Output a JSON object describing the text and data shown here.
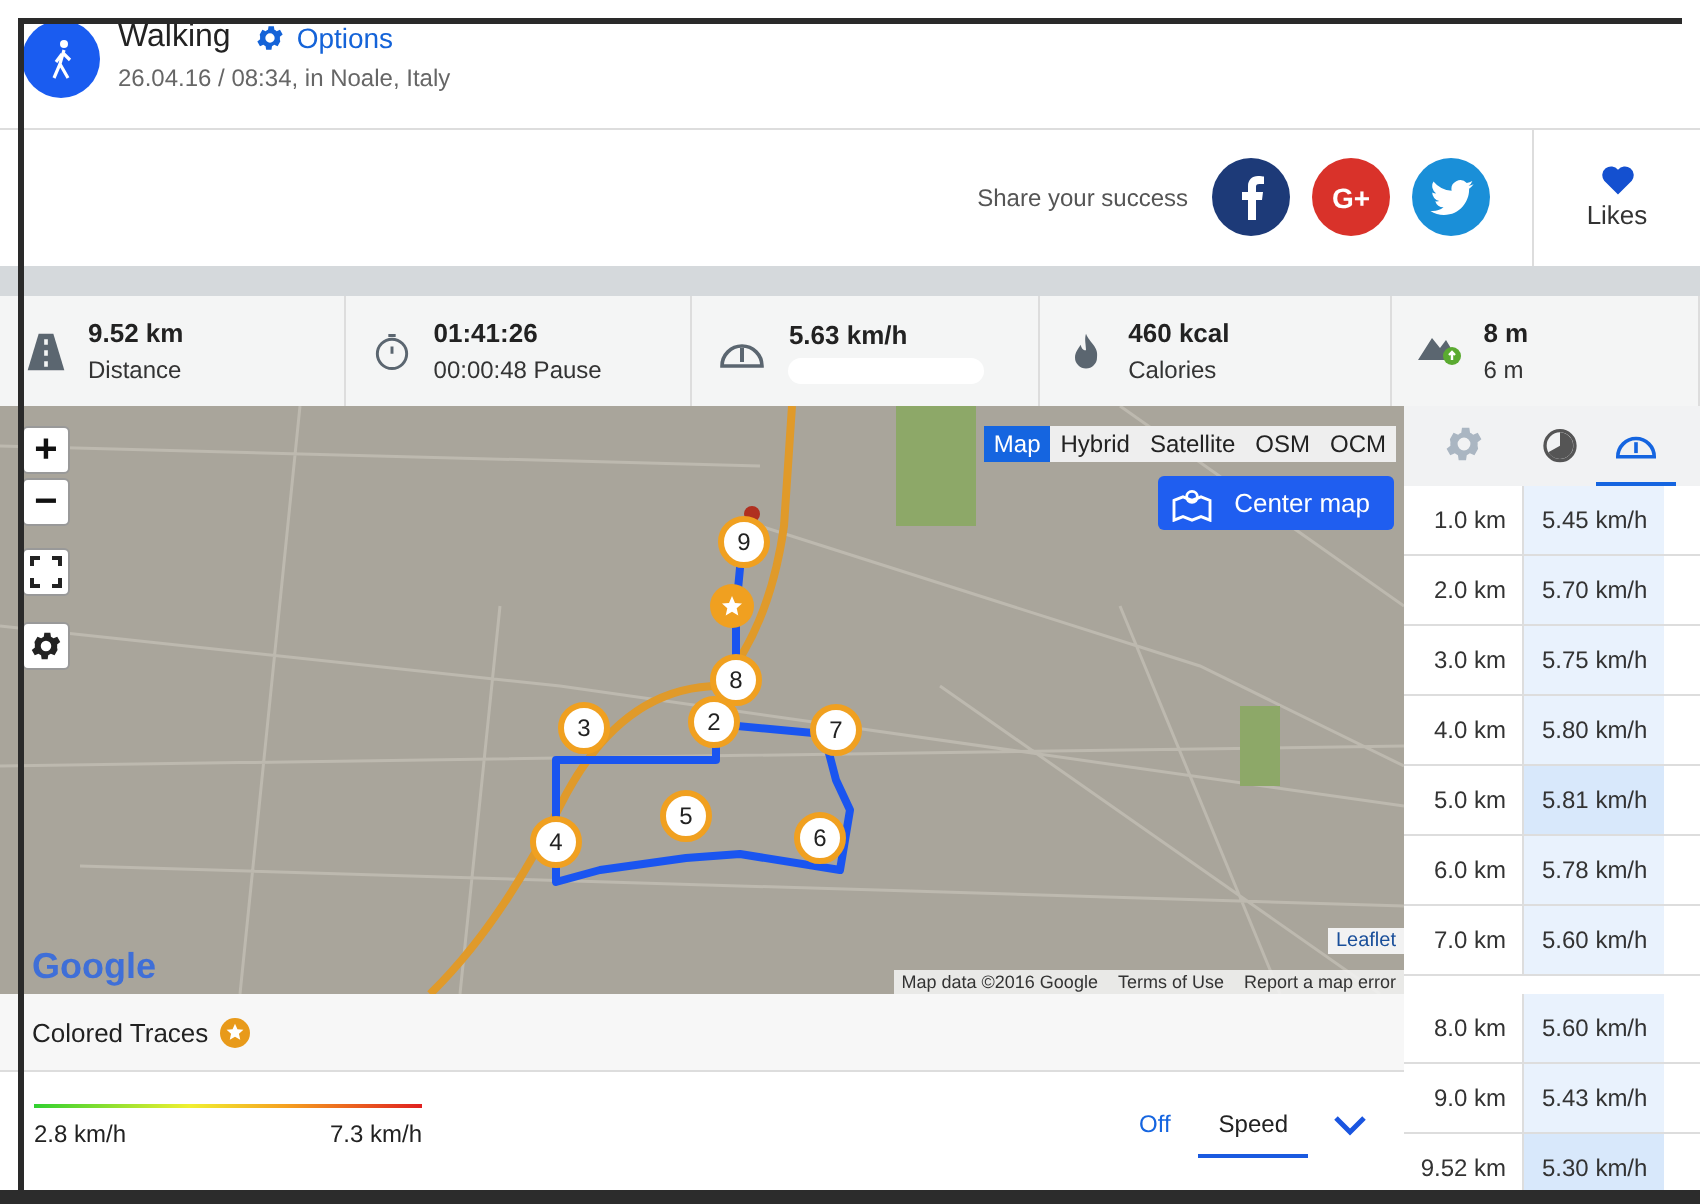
{
  "activity": {
    "title": "Walking",
    "options_link": "Options",
    "subtitle": "26.04.16 / 08:34, in Noale, Italy"
  },
  "share": {
    "label": "Share your success",
    "buttons": [
      {
        "kind": "facebook"
      },
      {
        "kind": "googleplus",
        "text": "G+"
      },
      {
        "kind": "twitter"
      }
    ],
    "likes": "Likes"
  },
  "stats": [
    {
      "kind": "road",
      "value": "9.52 km",
      "label": "Distance"
    },
    {
      "kind": "stopwatch",
      "value": "01:41:26",
      "label": "00:00:48 Pause"
    },
    {
      "kind": "speedometer",
      "value": "5.63 km/h",
      "blurred": true
    },
    {
      "kind": "flame",
      "value": "460 kcal",
      "label": "Calories"
    },
    {
      "kind": "elevation",
      "value": "8 m",
      "label": "6 m"
    }
  ],
  "map": {
    "zoom_in": "+",
    "zoom_out": "−",
    "types": [
      {
        "label": "Map",
        "selected": true
      },
      {
        "label": "Hybrid",
        "selected": false
      },
      {
        "label": "Satellite",
        "selected": false
      },
      {
        "label": "OSM",
        "selected": false
      },
      {
        "label": "OCM",
        "selected": false
      }
    ],
    "center_button": "Center map",
    "markers": [
      {
        "kind": "number",
        "label": "9"
      },
      {
        "kind": "star"
      },
      {
        "kind": "number",
        "label": "8"
      },
      {
        "kind": "number",
        "label": "3"
      },
      {
        "kind": "number",
        "label": "2"
      },
      {
        "kind": "number",
        "label": "7"
      },
      {
        "kind": "number",
        "label": "4"
      },
      {
        "kind": "number",
        "label": "5"
      },
      {
        "kind": "number",
        "label": "6"
      }
    ],
    "logo": "Google",
    "attribution": "Leaflet",
    "map_data": "Map data ©2016 Google",
    "terms": "Terms of Use",
    "report": "Report a map error"
  },
  "splits": {
    "tabs": [
      {
        "kind": "gear",
        "selected": false
      },
      {
        "kind": "stopwatch",
        "selected": false
      },
      {
        "kind": "speedometer",
        "selected": true
      }
    ],
    "rows": [
      {
        "distance": "1.0 km",
        "speed": "5.45 km/h",
        "selected": false
      },
      {
        "distance": "2.0 km",
        "speed": "5.70 km/h",
        "selected": false
      },
      {
        "distance": "3.0 km",
        "speed": "5.75 km/h",
        "selected": false
      },
      {
        "distance": "4.0 km",
        "speed": "5.80 km/h",
        "selected": false
      },
      {
        "distance": "5.0 km",
        "speed": "5.81 km/h",
        "selected": true
      },
      {
        "distance": "6.0 km",
        "speed": "5.78 km/h",
        "selected": false
      },
      {
        "distance": "7.0 km",
        "speed": "5.60 km/h",
        "selected": false
      },
      {
        "distance": "8.0 km",
        "speed": "5.60 km/h",
        "selected": false
      },
      {
        "distance": "9.0 km",
        "speed": "5.43 km/h",
        "selected": false
      },
      {
        "distance": "9.52 km",
        "speed": "5.30 km/h",
        "selected": true
      }
    ]
  },
  "colored_traces": {
    "title": "Colored Traces",
    "min": "2.8 km/h",
    "max": "7.3 km/h",
    "modes": [
      {
        "label": "Off",
        "selected": false
      },
      {
        "label": "Speed",
        "selected": true
      }
    ]
  }
}
